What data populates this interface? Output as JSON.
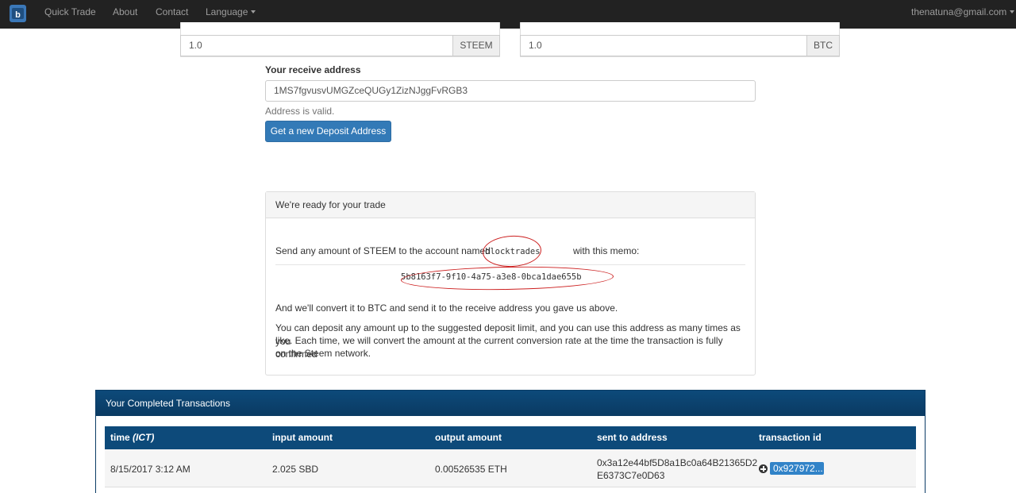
{
  "nav": {
    "items": [
      "Quick Trade",
      "About",
      "Contact"
    ],
    "language_label": "Language",
    "user_email": "thenatuna@gmail.com"
  },
  "trade": {
    "input_amount": "1.0",
    "input_currency": "STEEM",
    "output_amount": "1.0",
    "output_currency": "BTC"
  },
  "receive": {
    "label": "Your receive address",
    "address": "1MS7fgvusvUMGZceQUGy1ZizNJggFvRGB3",
    "status": "Address is valid.",
    "button": "Get a new Deposit Address"
  },
  "ready": {
    "heading": "We're ready for your trade",
    "send_prefix": "Send any amount of STEEM to the account named",
    "account": "blocktrades",
    "send_suffix": "with this memo:",
    "memo": "5b8163f7-9f10-4a75-a3e8-0bca1dae655b",
    "line2": "And we'll convert it to BTC and send it to the receive address you gave us above.",
    "line3a": "You can deposit any amount up to the suggested deposit limit, and you can use this address as many times as you",
    "line3b": "like. Each time, we will convert the amount at the current conversion rate at the time the transaction is fully confirmed",
    "line3c": "on the Steem network."
  },
  "transactions": {
    "heading": "Your Completed Transactions",
    "columns": {
      "time": "time ",
      "time_zone": "(ICT)",
      "input": "input amount",
      "output": "output amount",
      "sent_to": "sent to address",
      "tx_id": "transaction id"
    },
    "rows": [
      {
        "time": "8/15/2017 3:12 AM",
        "input": "2.025 SBD",
        "output": "0.00526535 ETH",
        "address_line1": "0x3a12e44bf5D8a1Bc0a64B21365D2",
        "address_line2": "E6373C7e0D63",
        "tx_id": "0x927972..."
      }
    ]
  },
  "colors": {
    "navbar": "#222222",
    "primary": "#337ab7",
    "table_header": "#0d4a7a",
    "annotation_red": "#cc1f1f"
  },
  "icons": [
    "site-logo-icon",
    "caret-down-icon",
    "plus-circle-icon"
  ]
}
